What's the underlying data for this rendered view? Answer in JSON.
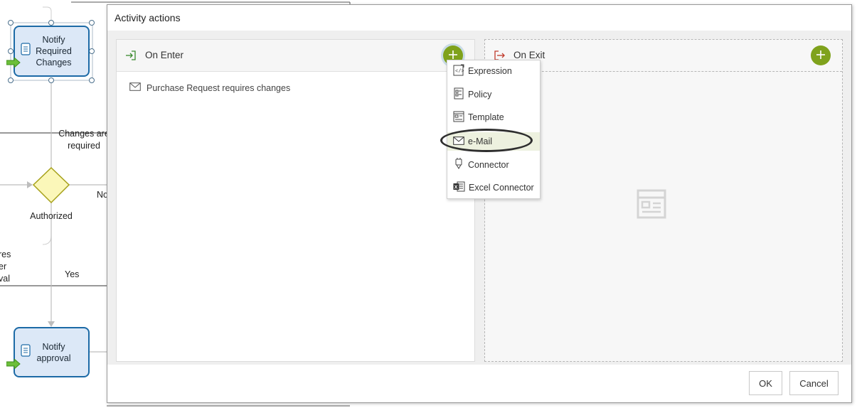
{
  "diagram": {
    "card_top_label": "Notify\nRequired\nChanges",
    "card_bottom_label": "Notify\napproval",
    "edge_changes_required": "Changes are\nrequired",
    "gateway_label": "Authorized",
    "edge_no": "No",
    "edge_yes": "Yes",
    "partial_left_text": "res\ner\nval"
  },
  "dialog": {
    "title": "Activity actions",
    "on_enter": {
      "title": "On Enter",
      "actions": [
        "Purchase Request requires changes"
      ]
    },
    "on_exit": {
      "title": "On Exit"
    },
    "add_menu": {
      "items": [
        {
          "label": "Expression",
          "icon": "expression-icon"
        },
        {
          "label": "Policy",
          "icon": "policy-icon"
        },
        {
          "label": "Template",
          "icon": "template-icon"
        },
        {
          "label": "e-Mail",
          "icon": "email-icon",
          "highlighted": true
        },
        {
          "label": "Connector",
          "icon": "connector-icon"
        },
        {
          "label": "Excel Connector",
          "icon": "excel-connector-icon"
        }
      ]
    },
    "ok_label": "OK",
    "cancel_label": "Cancel"
  },
  "colors": {
    "accent_green": "#7fa21c",
    "card_border": "#1c6aa6",
    "card_fill": "#dce8f7",
    "gateway_fill": "#fbf7b9",
    "highlight": "#edf1df"
  }
}
